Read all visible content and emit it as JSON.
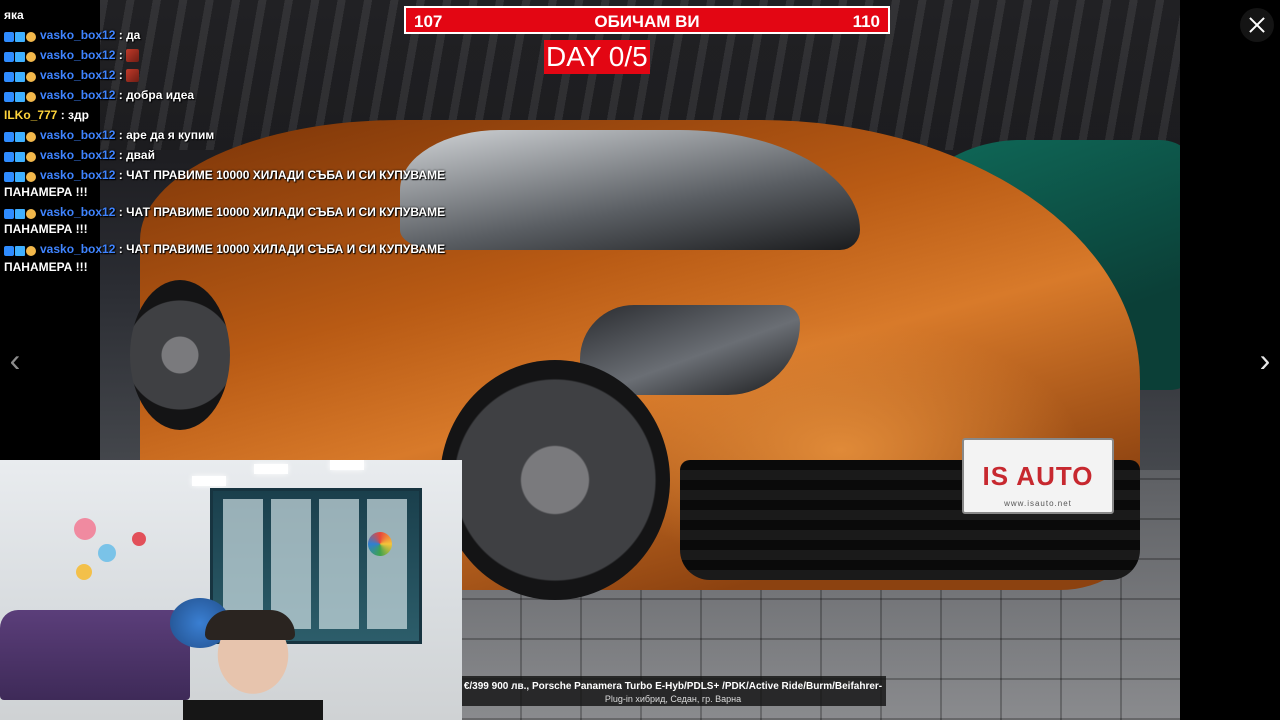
{
  "vote_bar": {
    "left_value": "107",
    "title": "ОБИЧАМ ВИ",
    "right_value": "110"
  },
  "day_badge": "DAY 0/5",
  "chat": {
    "messages": [
      {
        "text": "яка",
        "continuation": true
      },
      {
        "user": "vasko_box12",
        "text": ": да"
      },
      {
        "user": "vasko_box12",
        "text": ":",
        "emote": true
      },
      {
        "user": "vasko_box12",
        "text": ":",
        "emote": true
      },
      {
        "user": "vasko_box12",
        "text": ": добра идеа"
      },
      {
        "user": "ILKo_777",
        "text": ": здр"
      },
      {
        "user": "vasko_box12",
        "text": ": аре да я купим"
      },
      {
        "user": "vasko_box12",
        "text": ": двай"
      },
      {
        "user": "vasko_box12",
        "text": ": ЧАТ ПРАВИМЕ 10000 ХИЛАДИ СЪБА И СИ КУПУВАМЕ",
        "wrap": "ПАНАМЕРА !!!"
      },
      {
        "user": "vasko_box12",
        "text": ": ЧАТ ПРАВИМЕ 10000 ХИЛАДИ СЪБА И СИ КУПУВАМЕ",
        "wrap": "ПАНАМЕРА !!!"
      },
      {
        "user": "vasko_box12",
        "text": ": ЧАТ ПРАВИМЕ 10000 ХИЛАДИ СЪБА И СИ КУПУВАМЕ",
        "wrap": "ПАНАМЕРА !!!"
      }
    ]
  },
  "listing": {
    "caption_line1": "€/399 900 лв., Porsche Panamera Turbo E-Hyb/PDLS+ /PDK/Active Ride/Burm/Beifahrer-",
    "caption_line2": "Plug-in хибрид, Седан, гр. Варна",
    "plate_text": "IS AUTO",
    "plate_sub": "www.isauto.net"
  },
  "controls": {
    "prev_icon": "chevron-left-icon",
    "next_icon": "chevron-right-icon",
    "close_icon": "close-icon"
  },
  "colors": {
    "accent_red": "#e30613",
    "chat_user_blue": "#3f84ff",
    "chat_user_yellow": "#ffd53b"
  }
}
